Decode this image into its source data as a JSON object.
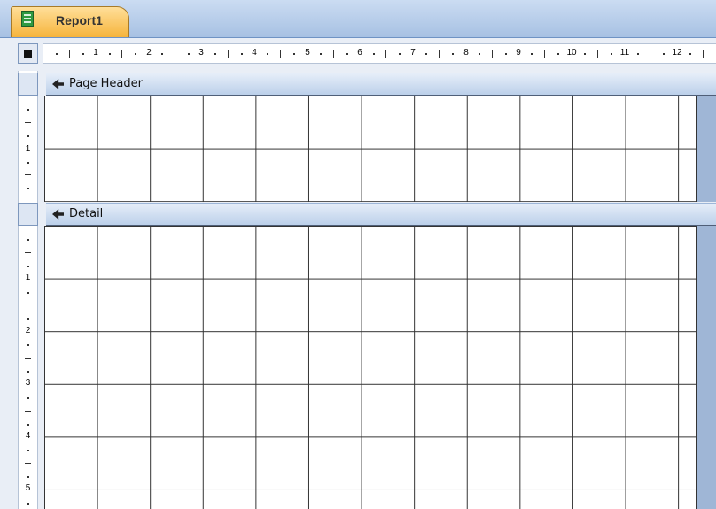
{
  "document_tab": {
    "title": "Report1",
    "icon": "report-icon"
  },
  "ruler_corner": {
    "icon": "select-report-icon"
  },
  "horizontal_ruler": {
    "labels": [
      "1",
      "2",
      "3",
      "4",
      "5",
      "6",
      "7",
      "8",
      "9",
      "10",
      "11",
      "12"
    ]
  },
  "vertical_ruler": {
    "labels": [
      "1",
      "1",
      "2",
      "3",
      "4",
      "5"
    ]
  },
  "sections": [
    {
      "label": "Page Header",
      "icon": "section-arrow-icon"
    },
    {
      "label": "Detail",
      "icon": "section-arrow-icon"
    }
  ]
}
